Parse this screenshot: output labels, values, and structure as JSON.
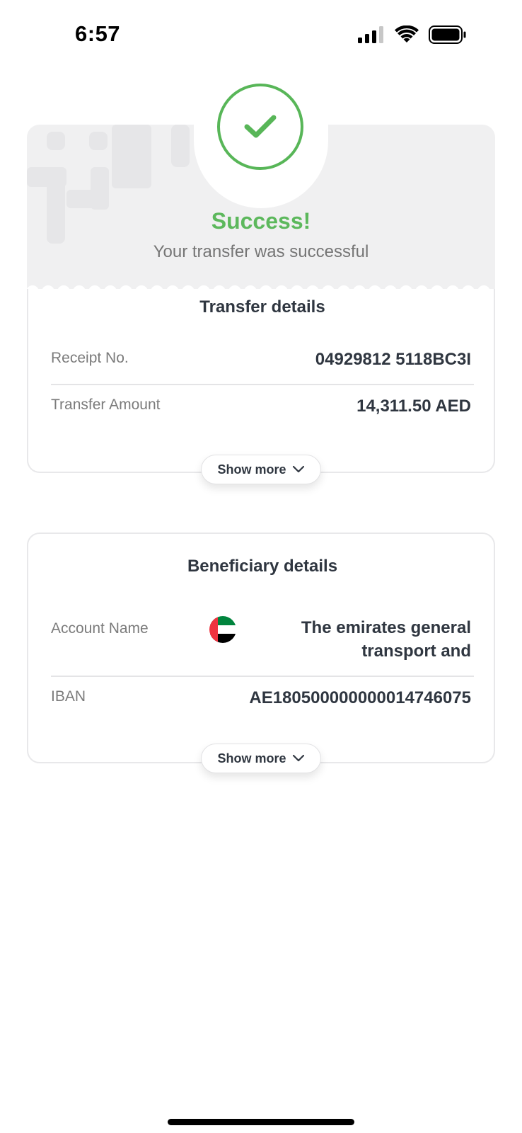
{
  "status_bar": {
    "time": "6:57",
    "signal_icon": "cellular-signal-icon",
    "wifi_icon": "wifi-icon",
    "battery_icon": "battery-icon"
  },
  "success": {
    "icon": "check-circle-icon",
    "title": "Success!",
    "subtitle": "Your transfer was successful"
  },
  "transfer_details": {
    "heading": "Transfer details",
    "rows": [
      {
        "label": "Receipt No.",
        "value": "04929812 5118BC3I"
      },
      {
        "label": "Transfer Amount",
        "value": "14,311.50 AED"
      }
    ],
    "show_more_label": "Show more"
  },
  "beneficiary_details": {
    "heading": "Beneficiary details",
    "account_name_label": "Account Name",
    "account_name_line1": "The emirates general",
    "account_name_line2": "transport and",
    "flag_icon": "uae-flag-icon",
    "iban_label": "IBAN",
    "iban_value": "AE180500000000014746075",
    "show_more_label": "Show more"
  },
  "colors": {
    "success_green": "#5cb85c",
    "text_dark": "#2f3640",
    "text_muted": "#7b7b7b",
    "header_bg": "#f0f0f1"
  }
}
